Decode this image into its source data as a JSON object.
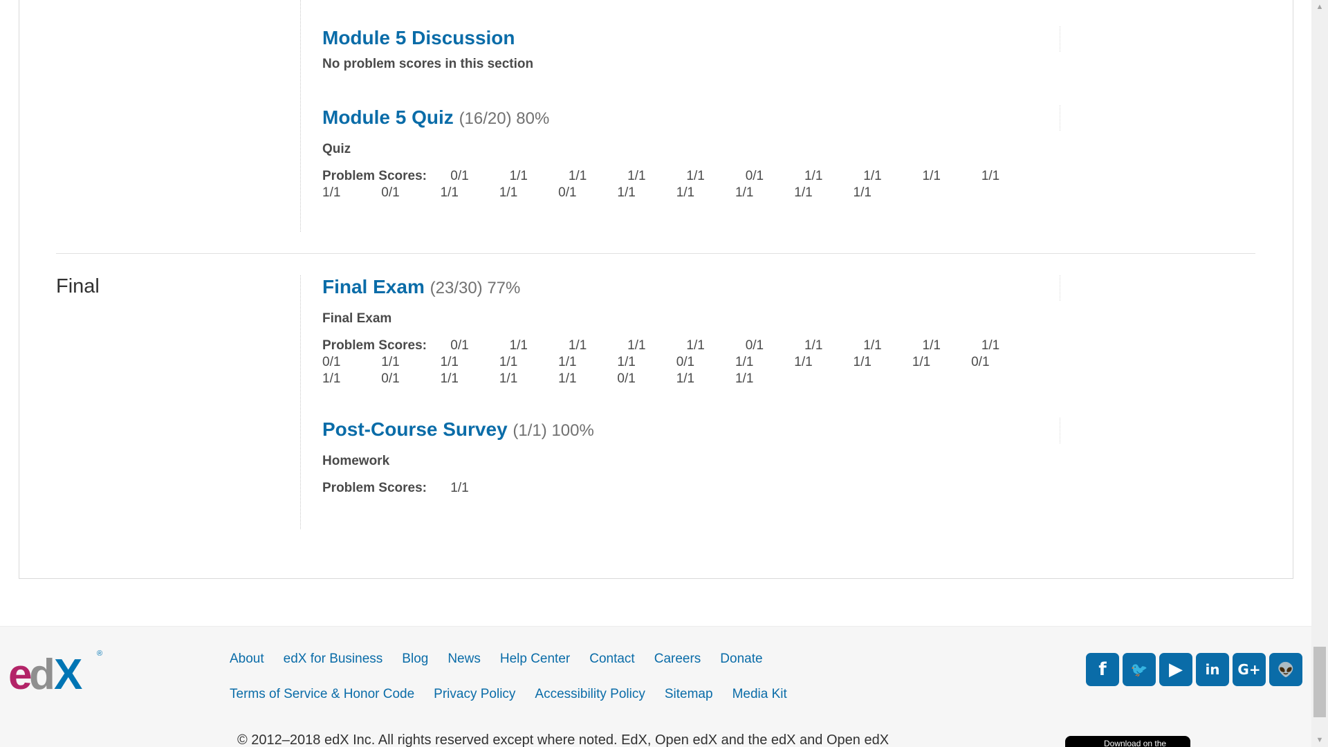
{
  "sections_top": [
    {
      "title": "Module 5 Discussion",
      "message": "No problem scores in this section"
    },
    {
      "title": "Module 5 Quiz",
      "score": "(16/20) 80%",
      "format": "Quiz",
      "scores_label": "Problem Scores:",
      "scores": [
        "0/1",
        "1/1",
        "1/1",
        "1/1",
        "1/1",
        "0/1",
        "1/1",
        "1/1",
        "1/1",
        "1/1",
        "1/1",
        "0/1",
        "1/1",
        "1/1",
        "0/1",
        "1/1",
        "1/1",
        "1/1",
        "1/1",
        "1/1"
      ]
    }
  ],
  "chapter": {
    "title": "Final",
    "sections": [
      {
        "title": "Final Exam",
        "score": "(23/30) 77%",
        "format": "Final Exam",
        "scores_label": "Problem Scores:",
        "scores": [
          "0/1",
          "1/1",
          "1/1",
          "1/1",
          "1/1",
          "0/1",
          "1/1",
          "1/1",
          "1/1",
          "1/1",
          "0/1",
          "1/1",
          "1/1",
          "1/1",
          "1/1",
          "1/1",
          "0/1",
          "1/1",
          "1/1",
          "1/1",
          "1/1",
          "0/1",
          "1/1",
          "0/1",
          "1/1",
          "1/1",
          "1/1",
          "0/1",
          "1/1",
          "1/1"
        ]
      },
      {
        "title": "Post-Course Survey",
        "score": "(1/1) 100%",
        "format": "Homework",
        "scores_label": "Problem Scores:",
        "scores": [
          "1/1"
        ]
      }
    ]
  },
  "footer": {
    "links_row1": [
      "About",
      "edX for Business",
      "Blog",
      "News",
      "Help Center",
      "Contact",
      "Careers",
      "Donate"
    ],
    "links_row2": [
      "Terms of Service & Honor Code",
      "Privacy Policy",
      "Accessibility Policy",
      "Sitemap",
      "Media Kit"
    ],
    "copyright": "© 2012–2018 edX Inc. All rights reserved except where noted. EdX, Open edX and the edX and Open edX",
    "social": [
      {
        "name": "facebook-icon",
        "glyph": "f"
      },
      {
        "name": "twitter-icon",
        "glyph": "🐦"
      },
      {
        "name": "youtube-icon",
        "glyph": "▶"
      },
      {
        "name": "linkedin-icon",
        "glyph": "in"
      },
      {
        "name": "google-plus-icon",
        "glyph": "G+"
      },
      {
        "name": "reddit-icon",
        "glyph": "👽"
      }
    ],
    "appstore_label": "Download on the",
    "logo_text": "edX",
    "logo_mark": "®"
  },
  "colors": {
    "link": "#0a6ca8",
    "text": "#313131"
  }
}
